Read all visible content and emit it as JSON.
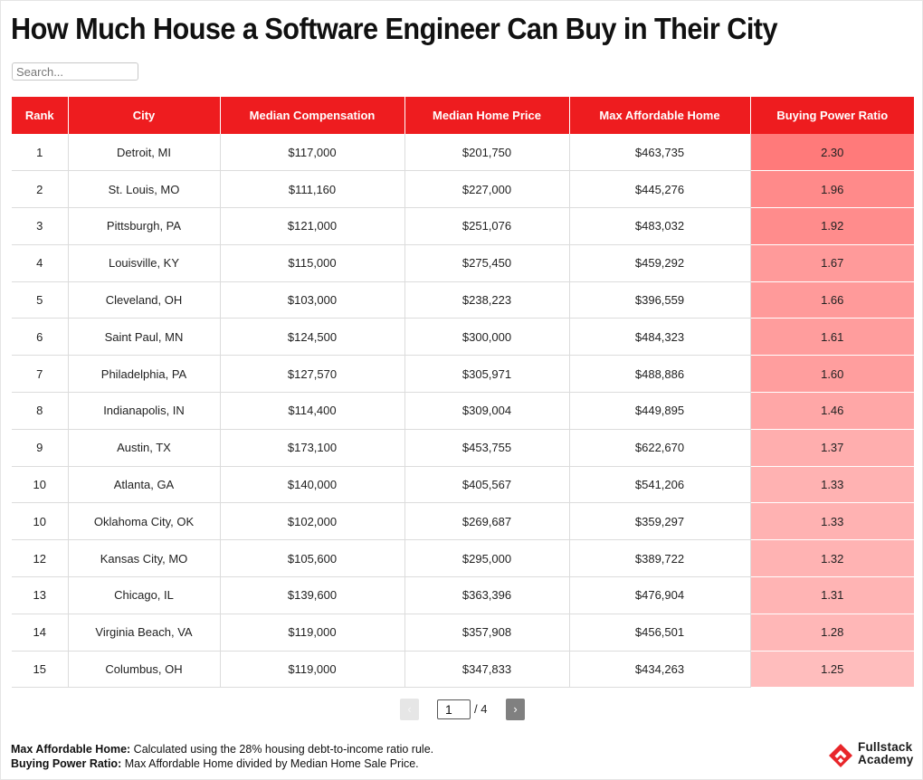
{
  "title": "How Much House a Software Engineer Can Buy in Their City",
  "search": {
    "placeholder": "Search...",
    "value": ""
  },
  "colors": {
    "header_bg": "#ee1c1f",
    "ratio_scale_high": "#ff7a7a",
    "ratio_scale_low": "#ffbdbd"
  },
  "table": {
    "headers": [
      "Rank",
      "City",
      "Median Compensation",
      "Median Home Price",
      "Max Affordable Home",
      "Buying Power Ratio"
    ],
    "rows": [
      {
        "rank": "1",
        "city": "Detroit, MI",
        "comp": "$117,000",
        "price": "$201,750",
        "max": "$463,735",
        "ratio": "2.30"
      },
      {
        "rank": "2",
        "city": "St. Louis, MO",
        "comp": "$111,160",
        "price": "$227,000",
        "max": "$445,276",
        "ratio": "1.96"
      },
      {
        "rank": "3",
        "city": "Pittsburgh, PA",
        "comp": "$121,000",
        "price": "$251,076",
        "max": "$483,032",
        "ratio": "1.92"
      },
      {
        "rank": "4",
        "city": "Louisville, KY",
        "comp": "$115,000",
        "price": "$275,450",
        "max": "$459,292",
        "ratio": "1.67"
      },
      {
        "rank": "5",
        "city": "Cleveland, OH",
        "comp": "$103,000",
        "price": "$238,223",
        "max": "$396,559",
        "ratio": "1.66"
      },
      {
        "rank": "6",
        "city": "Saint Paul, MN",
        "comp": "$124,500",
        "price": "$300,000",
        "max": "$484,323",
        "ratio": "1.61"
      },
      {
        "rank": "7",
        "city": "Philadelphia, PA",
        "comp": "$127,570",
        "price": "$305,971",
        "max": "$488,886",
        "ratio": "1.60"
      },
      {
        "rank": "8",
        "city": "Indianapolis, IN",
        "comp": "$114,400",
        "price": "$309,004",
        "max": "$449,895",
        "ratio": "1.46"
      },
      {
        "rank": "9",
        "city": "Austin, TX",
        "comp": "$173,100",
        "price": "$453,755",
        "max": "$622,670",
        "ratio": "1.37"
      },
      {
        "rank": "10",
        "city": "Atlanta, GA",
        "comp": "$140,000",
        "price": "$405,567",
        "max": "$541,206",
        "ratio": "1.33"
      },
      {
        "rank": "10",
        "city": "Oklahoma City, OK",
        "comp": "$102,000",
        "price": "$269,687",
        "max": "$359,297",
        "ratio": "1.33"
      },
      {
        "rank": "12",
        "city": "Kansas City, MO",
        "comp": "$105,600",
        "price": "$295,000",
        "max": "$389,722",
        "ratio": "1.32"
      },
      {
        "rank": "13",
        "city": "Chicago, IL",
        "comp": "$139,600",
        "price": "$363,396",
        "max": "$476,904",
        "ratio": "1.31"
      },
      {
        "rank": "14",
        "city": "Virginia Beach, VA",
        "comp": "$119,000",
        "price": "$357,908",
        "max": "$456,501",
        "ratio": "1.28"
      },
      {
        "rank": "15",
        "city": "Columbus, OH",
        "comp": "$119,000",
        "price": "$347,833",
        "max": "$434,263",
        "ratio": "1.25"
      }
    ]
  },
  "pagination": {
    "prev_icon": "‹",
    "next_icon": "›",
    "current_page": "1",
    "total_label": "/ 4"
  },
  "notes": [
    {
      "label": "Max Affordable Home:",
      "text": " Calculated using the 28% housing debt-to-income ratio rule."
    },
    {
      "label": "Buying Power Ratio:",
      "text": " Max Affordable Home divided by Median Home Sale Price."
    }
  ],
  "logo": {
    "line1": "Fullstack",
    "line2": "Academy",
    "icon": "fullstack-diamond-logo"
  }
}
